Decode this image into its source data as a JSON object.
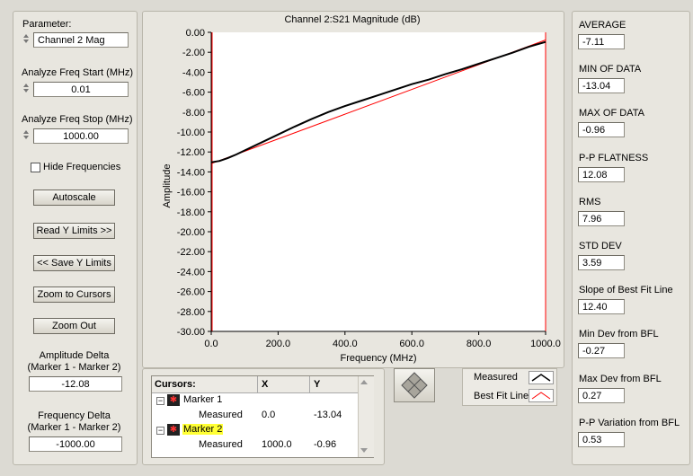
{
  "left": {
    "parameter_label": "Parameter:",
    "parameter_value": "Channel 2 Mag",
    "start_label": "Analyze Freq Start (MHz)",
    "start_value": "0.01",
    "stop_label": "Analyze Freq Stop (MHz)",
    "stop_value": "1000.00",
    "hide_freq_label": "Hide Frequencies",
    "buttons": {
      "autoscale": "Autoscale",
      "read_y": "Read Y Limits >>",
      "save_y": "<< Save Y Limits",
      "zoom_cursors": "Zoom to Cursors",
      "zoom_out": "Zoom Out"
    },
    "amp_delta_label1": "Amplitude Delta",
    "amp_delta_label2": "(Marker 1 - Marker 2)",
    "amp_delta_value": "-12.08",
    "freq_delta_label1": "Frequency Delta",
    "freq_delta_label2": "(Marker 1 - Marker 2)",
    "freq_delta_value": "-1000.00"
  },
  "chart_data": {
    "type": "line",
    "title": "Channel 2:S21 Magnitude (dB)",
    "xlabel": "Frequency (MHz)",
    "ylabel": "Amplitude",
    "xlim": [
      0,
      1000
    ],
    "ylim": [
      -30,
      0
    ],
    "xticks": [
      "0.0",
      "200.0",
      "400.0",
      "600.0",
      "800.0",
      "1000.0"
    ],
    "yticks": [
      "0.00",
      "-2.00",
      "-4.00",
      "-6.00",
      "-8.00",
      "-10.00",
      "-12.00",
      "-14.00",
      "-16.00",
      "-18.00",
      "-20.00",
      "-22.00",
      "-24.00",
      "-26.00",
      "-28.00",
      "-30.00"
    ],
    "grid": false,
    "series": [
      {
        "name": "Measured",
        "color": "#000000",
        "x": [
          0,
          25,
          50,
          75,
          100,
          150,
          200,
          250,
          300,
          350,
          400,
          450,
          500,
          550,
          600,
          650,
          700,
          750,
          800,
          850,
          900,
          950,
          1000
        ],
        "y": [
          -13.04,
          -12.9,
          -12.6,
          -12.25,
          -11.85,
          -11.05,
          -10.25,
          -9.45,
          -8.7,
          -8.0,
          -7.4,
          -6.85,
          -6.3,
          -5.75,
          -5.2,
          -4.75,
          -4.2,
          -3.7,
          -3.15,
          -2.6,
          -2.05,
          -1.45,
          -0.96
        ]
      },
      {
        "name": "Best Fit Line",
        "color": "#ff0000",
        "x": [
          0,
          1000
        ],
        "y": [
          -13.17,
          -0.77
        ]
      }
    ]
  },
  "cursors": {
    "headers": [
      "Cursors:",
      "X",
      "Y"
    ],
    "marker1": "Marker 1",
    "marker2": "Marker 2",
    "m1_label": "Measured",
    "m1_x": "0.0",
    "m1_y": "-13.04",
    "m2_label": "Measured",
    "m2_x": "1000.0",
    "m2_y": "-0.96"
  },
  "legend": {
    "measured": "Measured",
    "bfl": "Best Fit Line"
  },
  "stats": [
    {
      "label": "AVERAGE",
      "value": "-7.11"
    },
    {
      "label": "MIN OF DATA",
      "value": "-13.04"
    },
    {
      "label": "MAX OF DATA",
      "value": "-0.96"
    },
    {
      "label": "P-P FLATNESS",
      "value": "12.08"
    },
    {
      "label": "RMS",
      "value": "7.96"
    },
    {
      "label": "STD DEV",
      "value": "3.59"
    },
    {
      "label": "Slope of Best Fit Line",
      "value": "12.40"
    },
    {
      "label": "Min Dev from BFL",
      "value": "-0.27"
    },
    {
      "label": "Max Dev from BFL",
      "value": "0.27"
    },
    {
      "label": "P-P Variation from BFL",
      "value": "0.53"
    }
  ]
}
